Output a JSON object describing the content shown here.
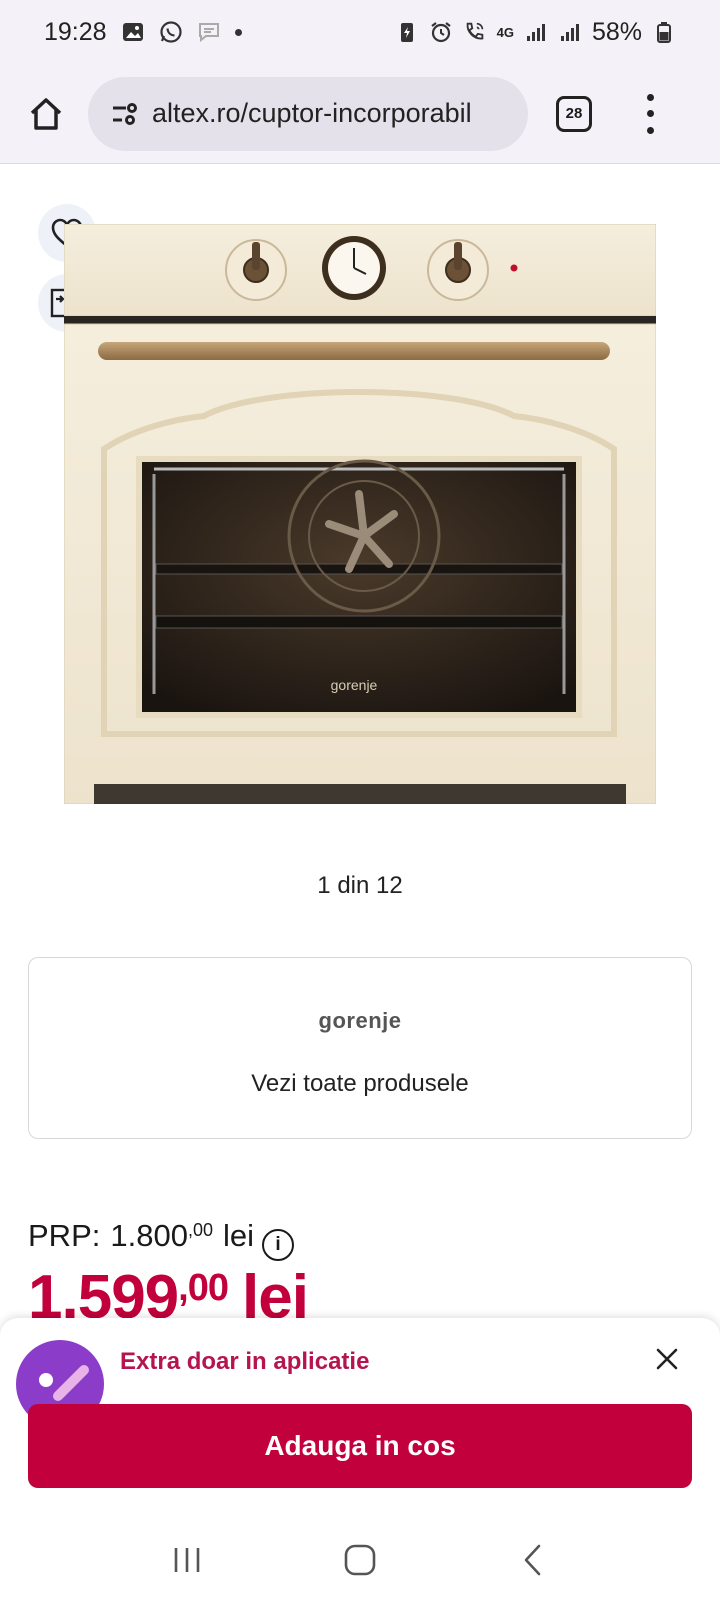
{
  "status_bar": {
    "time": "19:28",
    "battery": "58%",
    "network": "4G"
  },
  "browser": {
    "url": "altex.ro/cuptor-incorporabil",
    "tab_count": "28"
  },
  "product": {
    "image_counter": "1 din 12",
    "oven_brand_mark": "gorenje"
  },
  "brand_card": {
    "logo": "gorenje",
    "link_label": "Vezi toate produsele"
  },
  "pricing": {
    "prp_label": "PRP:",
    "prp_main": "1.800",
    "prp_decimals": ",00",
    "prp_currency": "lei",
    "price_main": "1.599",
    "price_decimals": ",00",
    "price_currency": "lei"
  },
  "promo": {
    "text": "Extra doar in aplicatie",
    "cta_label": "Adauga in cos"
  },
  "colors": {
    "accent": "#c2003b",
    "promo_text": "#b5144f",
    "badge": "#8b3cc9"
  }
}
